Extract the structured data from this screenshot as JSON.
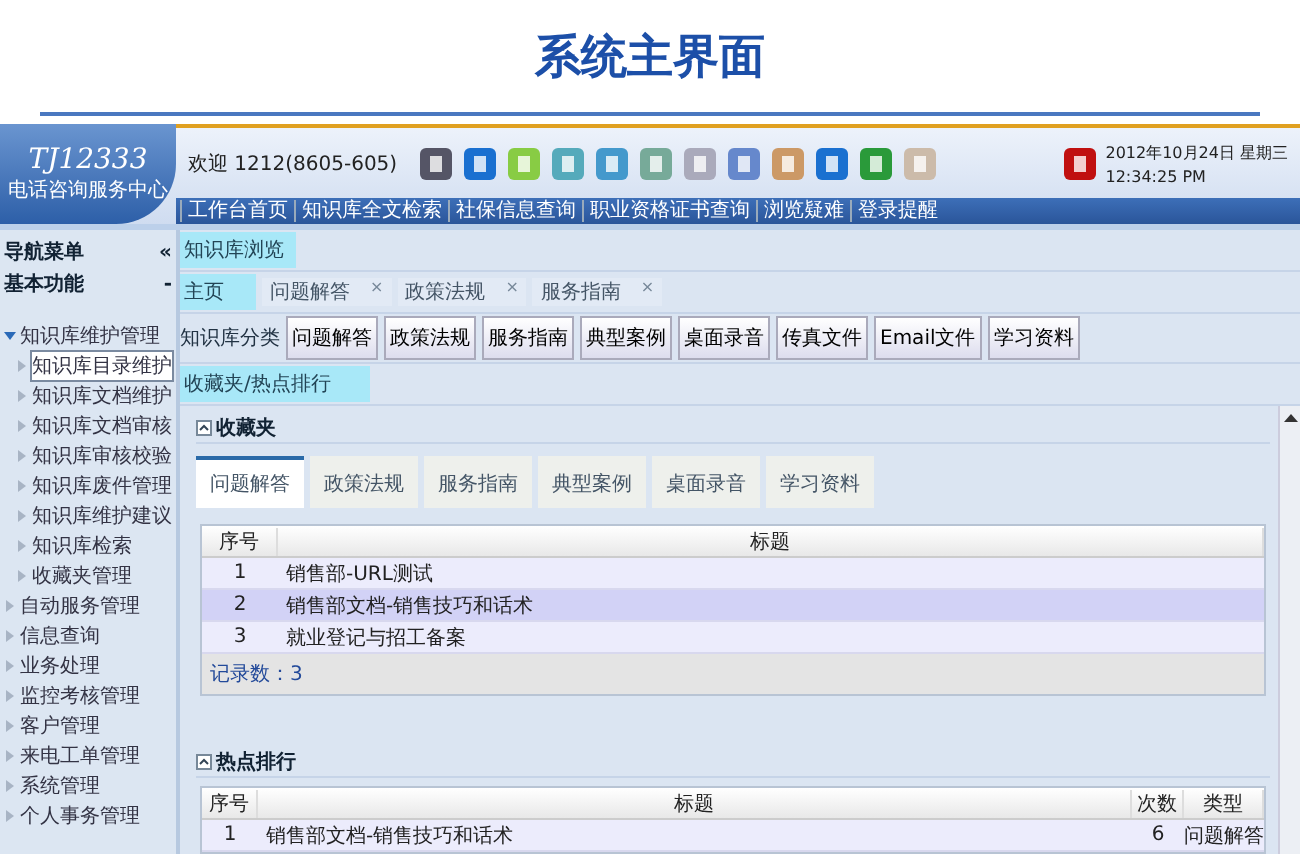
{
  "page_title": "系统主界面",
  "header": {
    "logo_title": "TJ12333",
    "logo_subtitle": "电话咨询服务中心",
    "welcome": "欢迎 1212(8605-605)",
    "date": "2012年10月24日 星期三",
    "time": "12:34:25 PM",
    "nav_links": [
      "工作台首页",
      "知识库全文检索",
      "社保信息查询",
      "职业资格证书查询",
      "浏览疑难",
      "登录提醒"
    ]
  },
  "sidebar": {
    "title": "导航菜单",
    "collapse": "«",
    "section": "基本功能",
    "section_toggle": "-",
    "items": [
      {
        "label": "知识库维护管理",
        "expanded": true,
        "selected": false,
        "children": [
          {
            "label": "知识库目录维护",
            "selected": true
          },
          {
            "label": "知识库文档维护",
            "selected": false
          },
          {
            "label": "知识库文档审核",
            "selected": false
          },
          {
            "label": "知识库审核校验",
            "selected": false
          },
          {
            "label": "知识库废件管理",
            "selected": false
          },
          {
            "label": "知识库维护建议",
            "selected": false
          },
          {
            "label": "知识库检索",
            "selected": false
          },
          {
            "label": "收藏夹管理",
            "selected": false
          }
        ]
      },
      {
        "label": "自动服务管理",
        "expanded": false,
        "selected": false
      },
      {
        "label": "信息查询",
        "expanded": false,
        "selected": false
      },
      {
        "label": "业务处理",
        "expanded": false,
        "selected": false
      },
      {
        "label": "监控考核管理",
        "expanded": false,
        "selected": false
      },
      {
        "label": "客户管理",
        "expanded": false,
        "selected": false
      },
      {
        "label": "来电工单管理",
        "expanded": false,
        "selected": false
      },
      {
        "label": "系统管理",
        "expanded": false,
        "selected": false
      },
      {
        "label": "个人事务管理",
        "expanded": false,
        "selected": false
      }
    ]
  },
  "breadcrumb": "知识库浏览",
  "home": "主页",
  "open_tabs": [
    {
      "label": "问题解答",
      "close": "×"
    },
    {
      "label": "政策法规",
      "close": "×"
    },
    {
      "label": "服务指南",
      "close": "×"
    }
  ],
  "category_label": "知识库分类",
  "categories": [
    "问题解答",
    "政策法规",
    "服务指南",
    "典型案例",
    "桌面录音",
    "传真文件",
    "Email文件",
    "学习资料"
  ],
  "favorites_link": "收藏夹/热点排行",
  "favorites": {
    "title": "收藏夹",
    "tabs": [
      {
        "label": "问题解答",
        "selected": true
      },
      {
        "label": "政策法规",
        "selected": false
      },
      {
        "label": "服务指南",
        "selected": false
      },
      {
        "label": "典型案例",
        "selected": false
      },
      {
        "label": "桌面录音",
        "selected": false
      },
      {
        "label": "学习资料",
        "selected": false
      }
    ],
    "columns": [
      "序号",
      "标题"
    ],
    "rows": [
      {
        "no": "1",
        "title": "销售部-URL测试",
        "selected": false
      },
      {
        "no": "2",
        "title": "销售部文档-销售技巧和话术",
        "selected": true
      },
      {
        "no": "3",
        "title": "就业登记与招工备案",
        "selected": false
      }
    ],
    "footer": "记录数：3"
  },
  "hot": {
    "title": "热点排行",
    "columns": [
      "序号",
      "标题",
      "次数",
      "类型"
    ],
    "rows": [
      {
        "no": "1",
        "title": "销售部文档-销售技巧和话术",
        "count": "6",
        "type": "问题解答"
      }
    ]
  }
}
